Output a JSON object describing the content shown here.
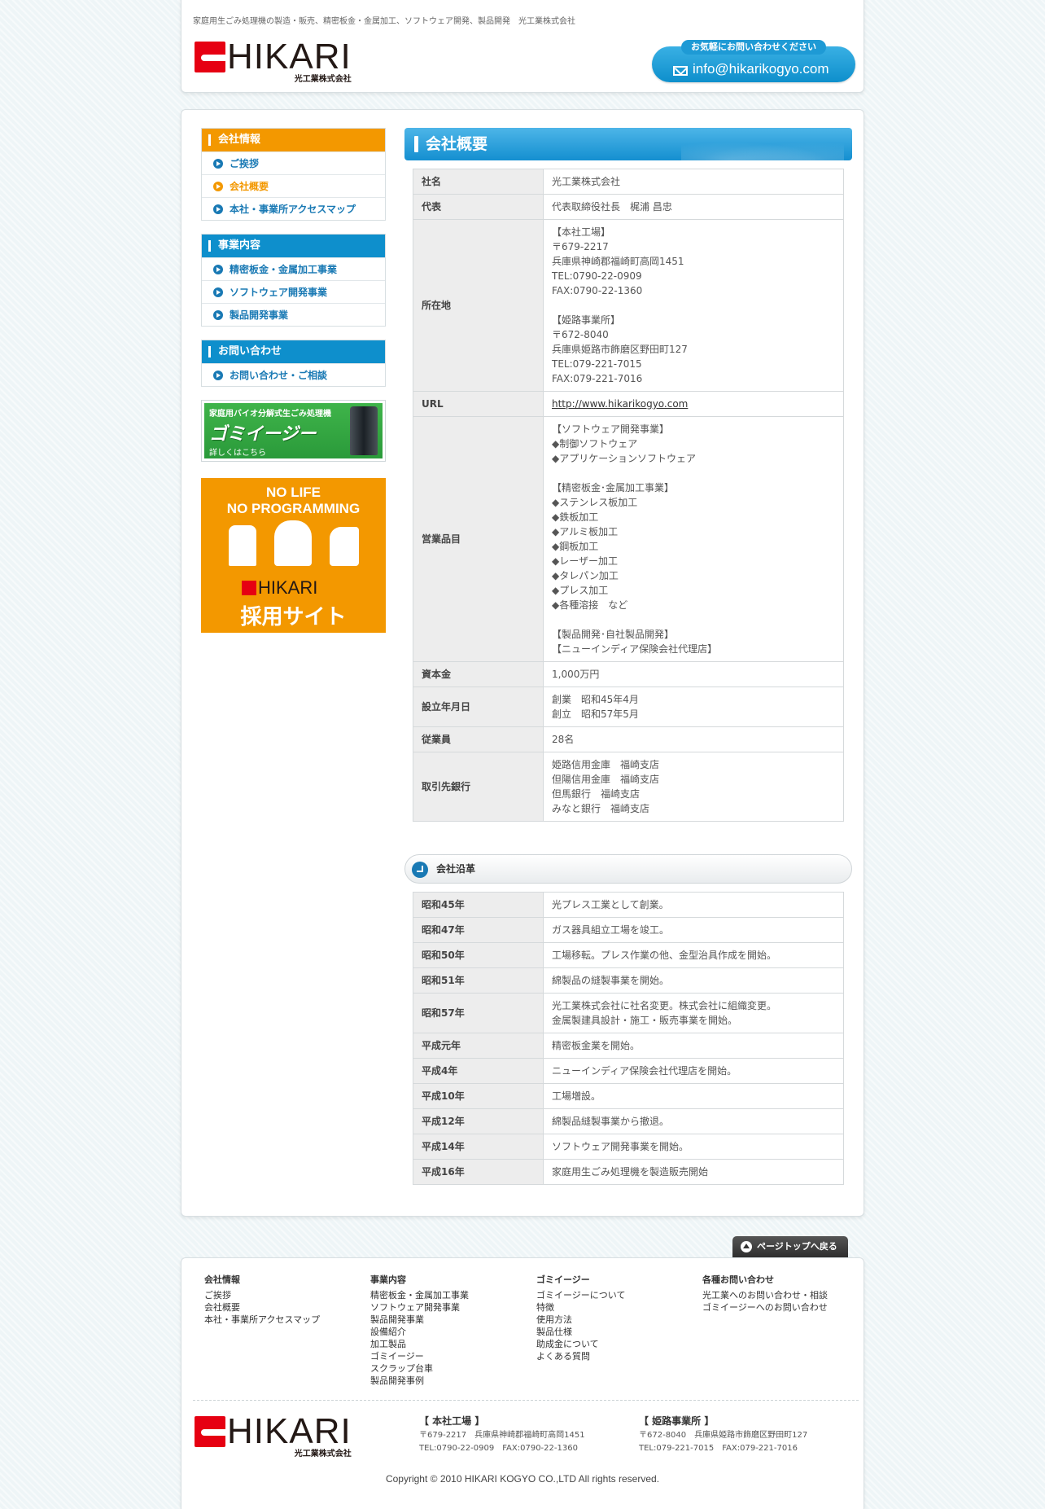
{
  "header": {
    "tagline": "家庭用生ごみ処理機の製造・販売、精密板金・金属加工、ソフトウェア開発、製品開発　光工業株式会社",
    "logo_word": "HIKARI",
    "logo_sub": "光工業株式会社",
    "contact_caption": "お気軽にお問い合わせください",
    "contact_email": "info@hikarikogyo.com"
  },
  "sidebar": {
    "sections": [
      {
        "title": "会社情報",
        "color": "#f39800",
        "items": [
          "ご挨拶",
          "会社概要",
          "本社・事業所アクセスマップ"
        ],
        "active": 1
      },
      {
        "title": "事業内容",
        "color": "#0e8fcc",
        "items": [
          "精密板金・金属加工事業",
          "ソフトウェア開発事業",
          "製品開発事業"
        ],
        "active": -1
      },
      {
        "title": "お問い合わせ",
        "color": "#0e8fcc",
        "items": [
          "お問い合わせ・ご相談"
        ],
        "active": -1
      }
    ],
    "gomi_banner": {
      "line1": "家庭用バイオ分解式生ごみ処理機",
      "line2": "ゴミイージー",
      "line3": "詳しくはこちら"
    },
    "recruit_banner": {
      "line1": "NO LIFE",
      "line2": "NO PROGRAMMING",
      "logo": "HIKARI",
      "line3": "採用サイト"
    }
  },
  "main": {
    "title": "会社概要",
    "profile": [
      {
        "label": "社名",
        "value": "光工業株式会社"
      },
      {
        "label": "代表",
        "value": "代表取締役社長　梶浦 昌忠"
      },
      {
        "label": "所在地",
        "value": "【本社工場】\n〒679-2217\n兵庫県神崎郡福崎町高岡1451\nTEL:0790-22-0909\nFAX:0790-22-1360\n\n【姫路事業所】\n〒672-8040\n兵庫県姫路市飾磨区野田町127\nTEL:079-221-7015\nFAX:079-221-7016"
      },
      {
        "label": "URL",
        "value": "http://www.hikarikogyo.com",
        "link": true
      },
      {
        "label": "営業品目",
        "value": "【ソフトウェア開発事業】\n◆制御ソフトウェア\n◆アプリケーションソフトウェア\n\n【精密板金･金属加工事業】\n◆ステンレス板加工\n◆鉄板加工\n◆アルミ板加工\n◆鋼板加工\n◆レーザー加工\n◆タレパン加工\n◆プレス加工\n◆各種溶接　など\n\n【製品開発･自社製品開発】\n【ニューインディア保険会社代理店】"
      },
      {
        "label": "資本金",
        "value": "1,000万円"
      },
      {
        "label": "設立年月日",
        "value": "創業　昭和45年4月\n創立　昭和57年5月"
      },
      {
        "label": "従業員",
        "value": "28名"
      },
      {
        "label": "取引先銀行",
        "value": "姫路信用金庫　福崎支店\n但陽信用金庫　福崎支店\n但馬銀行　福崎支店\nみなと銀行　福崎支店"
      }
    ],
    "history_title": "会社沿革",
    "history": [
      {
        "label": "昭和45年",
        "value": "光プレス工業として創業。"
      },
      {
        "label": "昭和47年",
        "value": "ガス器具組立工場を竣工。"
      },
      {
        "label": "昭和50年",
        "value": "工場移転。プレス作業の他、金型治具作成を開始。"
      },
      {
        "label": "昭和51年",
        "value": "綿製品の縫製事業を開始。"
      },
      {
        "label": "昭和57年",
        "value": "光工業株式会社に社名変更。株式会社に組織変更。\n金属製建具設計・施工・販売事業を開始。"
      },
      {
        "label": "平成元年",
        "value": "精密板金業を開始。"
      },
      {
        "label": "平成4年",
        "value": "ニューインディア保険会社代理店を開始。"
      },
      {
        "label": "平成10年",
        "value": "工場増設。"
      },
      {
        "label": "平成12年",
        "value": "綿製品縫製事業から撤退。"
      },
      {
        "label": "平成14年",
        "value": "ソフトウェア開発事業を開始。"
      },
      {
        "label": "平成16年",
        "value": "家庭用生ごみ処理機を製造販売開始"
      }
    ]
  },
  "pagetop_label": "ページトップへ戻る",
  "footer": {
    "columns": [
      {
        "title": "会社情報",
        "items": [
          "ご挨拶",
          "会社概要",
          "本社・事業所アクセスマップ"
        ]
      },
      {
        "title": "事業内容",
        "items": [
          "精密板金・金属加工事業",
          "ソフトウェア開発事業",
          "製品開発事業",
          "設備紹介",
          "加工製品",
          "ゴミイージー",
          "スクラップ台車",
          "製品開発事例"
        ]
      },
      {
        "title": "ゴミイージー",
        "items": [
          "ゴミイージーについて",
          "特徴",
          "使用方法",
          "製品仕様",
          "助成金について",
          "よくある質問"
        ]
      },
      {
        "title": "各種お問い合わせ",
        "items": [
          "光工業へのお問い合わせ・相談",
          "ゴミイージーへのお問い合わせ"
        ]
      }
    ],
    "addresses": [
      {
        "title": "【 本社工場 】",
        "line1": "〒679-2217　兵庫県神崎郡福崎町高岡1451",
        "line2": "TEL:0790-22-0909　FAX:0790-22-1360"
      },
      {
        "title": "【 姫路事業所 】",
        "line1": "〒672-8040　兵庫県姫路市飾磨区野田町127",
        "line2": "TEL:079-221-7015　FAX:079-221-7016"
      }
    ],
    "copyright": "Copyright © 2010 HIKARI KOGYO CO.,LTD All rights reserved."
  }
}
